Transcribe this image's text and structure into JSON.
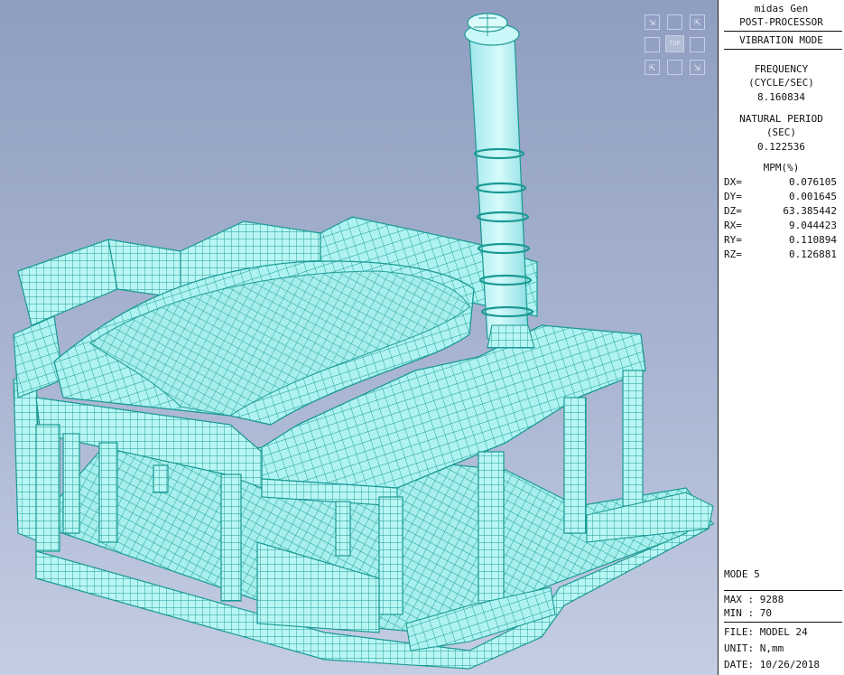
{
  "app": {
    "line1": "midas Gen",
    "line2": "POST-PROCESSOR",
    "mode_title": "VIBRATION MODE"
  },
  "frequency": {
    "label1": "FREQUENCY",
    "label2": "(CYCLE/SEC)",
    "value": "8.160834"
  },
  "period": {
    "label1": "NATURAL PERIOD",
    "label2": "(SEC)",
    "value": "0.122536"
  },
  "mpm": {
    "label": "MPM(%)",
    "rows": [
      {
        "k": "DX=",
        "v": "0.076105"
      },
      {
        "k": "DY=",
        "v": "0.001645"
      },
      {
        "k": "DZ=",
        "v": "63.385442"
      },
      {
        "k": "RX=",
        "v": "9.044423"
      },
      {
        "k": "RY=",
        "v": "0.110894"
      },
      {
        "k": "RZ=",
        "v": "0.126881"
      }
    ]
  },
  "mode": "MODE 5",
  "max": "MAX : 9288",
  "min": "MIN : 70",
  "file": "FILE: MODEL 24",
  "unit": "UNIT: N,mm",
  "date": "DATE: 10/26/2018",
  "viewcube": {
    "top_label": "TOP",
    "arrow_nw": "⇲",
    "arrow_ne": "⇱",
    "arrow_sw": "⇱",
    "arrow_se": "⇲"
  },
  "colors": {
    "mesh_fill": "#aef3f1",
    "mesh_line": "#1a9a94",
    "background_top": "#8f9ec0",
    "background_bottom": "#c4cde2"
  }
}
